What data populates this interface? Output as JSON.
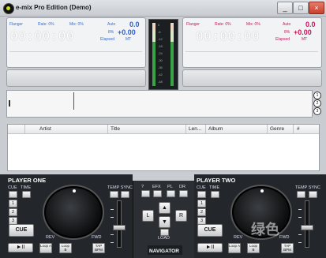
{
  "app": {
    "title": "e-mix Pro Edition (Demo)"
  },
  "window": {
    "min_label": "_",
    "max_label": "□",
    "close_label": "×"
  },
  "deck_left": {
    "flanger": "Flanger",
    "rate": "Rate: 0%",
    "mix": "Mix: 0%",
    "auto": "Auto",
    "bpm": "0.0",
    "pitch_pct": "8%",
    "pitch": "+0.00",
    "elapsed": "Elapsed",
    "mt": "MT",
    "time": "00:00:00"
  },
  "deck_right": {
    "flanger": "Flanger",
    "rate": "Rate: 0%",
    "mix": "Mix: 0%",
    "auto": "Auto",
    "bpm": "0.0",
    "pitch_pct": "8%",
    "pitch": "+0.00",
    "elapsed": "Elapsed",
    "mt": "MT",
    "time": "00:00:00"
  },
  "vu_scale": [
    "0",
    "-6",
    "-12",
    "-18",
    "-24",
    "-30",
    "-36",
    "-42",
    "-48"
  ],
  "side_buttons": [
    "1",
    "2",
    "3"
  ],
  "playlist": {
    "columns": [
      "Artist",
      "Title",
      "Len...",
      "Album",
      "Genre",
      "#"
    ]
  },
  "player_one": {
    "title": "PLAYER ONE",
    "cue_label": "CUE",
    "time_label": "TIME",
    "temp_sync": "TEMP SYNC",
    "hotcues": [
      "1",
      "2",
      "3"
    ],
    "cue_button": "CUE",
    "rev": "REV",
    "fwd": "FWD",
    "play": "►II",
    "loop_a": "Loop A",
    "loop_b": "Loop B",
    "tap_bpm": "TAP BPM"
  },
  "player_two": {
    "title": "PLAYER TWO",
    "cue_label": "CUE",
    "time_label": "TIME",
    "temp_sync": "TEMP SYNC",
    "hotcues": [
      "1",
      "2",
      "3"
    ],
    "cue_button": "CUE",
    "rev": "REV",
    "fwd": "FWD",
    "play": "►II",
    "loop_a": "Loop A",
    "loop_b": "Loop B",
    "tap_bpm": "TAP BPM"
  },
  "navigator": {
    "tabs": [
      "?",
      "EFX",
      "PL",
      "DR"
    ],
    "up": "▲",
    "down": "▼",
    "left": "L",
    "right": "R",
    "load": "LOAD",
    "title": "NAVIGATOR"
  },
  "watermark": "绿色"
}
